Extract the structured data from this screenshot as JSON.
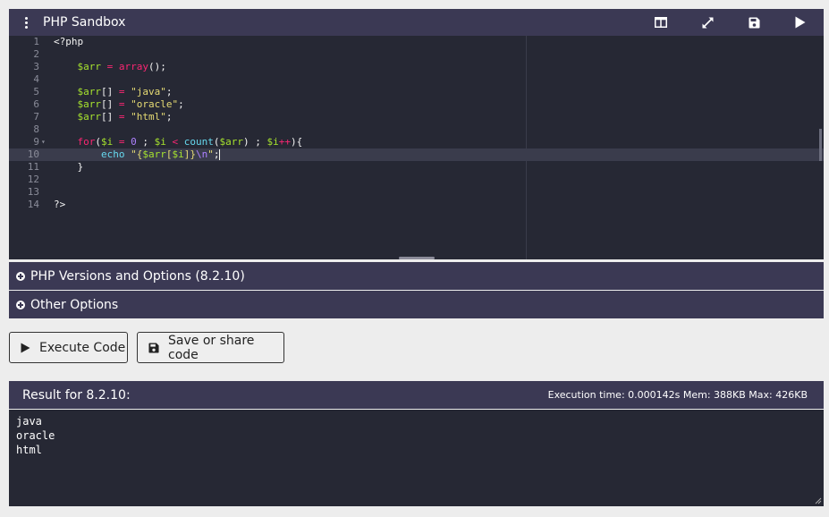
{
  "header": {
    "title": "PHP Sandbox",
    "menu_icon": "kebab-menu-icon",
    "tools": [
      {
        "name": "split-view-button",
        "icon": "split-layout-icon"
      },
      {
        "name": "fullscreen-button",
        "icon": "expand-icon"
      },
      {
        "name": "save-button",
        "icon": "floppy-disk-icon"
      },
      {
        "name": "run-button",
        "icon": "play-icon"
      }
    ]
  },
  "editor": {
    "lines": [
      {
        "num": "1",
        "tokens": [
          {
            "t": "<?php",
            "c": "plain"
          }
        ]
      },
      {
        "num": "2",
        "tokens": []
      },
      {
        "num": "3",
        "tokens": [
          {
            "t": "    ",
            "c": "plain"
          },
          {
            "t": "$arr",
            "c": "var"
          },
          {
            "t": " = ",
            "c": "kw"
          },
          {
            "t": "array",
            "c": "kw"
          },
          {
            "t": "();",
            "c": "plain"
          }
        ]
      },
      {
        "num": "4",
        "tokens": []
      },
      {
        "num": "5",
        "tokens": [
          {
            "t": "    ",
            "c": "plain"
          },
          {
            "t": "$arr",
            "c": "var"
          },
          {
            "t": "[] ",
            "c": "plain"
          },
          {
            "t": "=",
            "c": "kw"
          },
          {
            "t": " ",
            "c": "plain"
          },
          {
            "t": "\"java\"",
            "c": "str"
          },
          {
            "t": ";",
            "c": "plain"
          }
        ]
      },
      {
        "num": "6",
        "tokens": [
          {
            "t": "    ",
            "c": "plain"
          },
          {
            "t": "$arr",
            "c": "var"
          },
          {
            "t": "[] ",
            "c": "plain"
          },
          {
            "t": "=",
            "c": "kw"
          },
          {
            "t": " ",
            "c": "plain"
          },
          {
            "t": "\"oracle\"",
            "c": "str"
          },
          {
            "t": ";",
            "c": "plain"
          }
        ]
      },
      {
        "num": "7",
        "tokens": [
          {
            "t": "    ",
            "c": "plain"
          },
          {
            "t": "$arr",
            "c": "var"
          },
          {
            "t": "[] ",
            "c": "plain"
          },
          {
            "t": "=",
            "c": "kw"
          },
          {
            "t": " ",
            "c": "plain"
          },
          {
            "t": "\"html\"",
            "c": "str"
          },
          {
            "t": ";",
            "c": "plain"
          }
        ]
      },
      {
        "num": "8",
        "tokens": []
      },
      {
        "num": "9",
        "fold": true,
        "tokens": [
          {
            "t": "    ",
            "c": "plain"
          },
          {
            "t": "for",
            "c": "kw"
          },
          {
            "t": "(",
            "c": "plain"
          },
          {
            "t": "$i",
            "c": "var"
          },
          {
            "t": " = ",
            "c": "kw"
          },
          {
            "t": "0",
            "c": "num"
          },
          {
            "t": " ; ",
            "c": "plain"
          },
          {
            "t": "$i",
            "c": "var"
          },
          {
            "t": " < ",
            "c": "kw"
          },
          {
            "t": "count",
            "c": "fn"
          },
          {
            "t": "(",
            "c": "plain"
          },
          {
            "t": "$arr",
            "c": "var"
          },
          {
            "t": ") ; ",
            "c": "plain"
          },
          {
            "t": "$i",
            "c": "var"
          },
          {
            "t": "++",
            "c": "kw"
          },
          {
            "t": "){",
            "c": "plain"
          }
        ]
      },
      {
        "num": "10",
        "active": true,
        "tokens": [
          {
            "t": "        ",
            "c": "plain"
          },
          {
            "t": "echo",
            "c": "fn"
          },
          {
            "t": " ",
            "c": "plain"
          },
          {
            "t": "\"{",
            "c": "str"
          },
          {
            "t": "$arr",
            "c": "var"
          },
          {
            "t": "[",
            "c": "str"
          },
          {
            "t": "$i",
            "c": "var"
          },
          {
            "t": "]}",
            "c": "str"
          },
          {
            "t": "\\n",
            "c": "num"
          },
          {
            "t": "\"",
            "c": "str"
          },
          {
            "t": ";",
            "c": "plain"
          }
        ]
      },
      {
        "num": "11",
        "tokens": [
          {
            "t": "    }",
            "c": "plain"
          }
        ]
      },
      {
        "num": "12",
        "tokens": []
      },
      {
        "num": "13",
        "tokens": []
      },
      {
        "num": "14",
        "tokens": [
          {
            "t": "?>",
            "c": "plain"
          }
        ]
      }
    ]
  },
  "options": {
    "versions_label": "PHP Versions and Options (8.2.10)",
    "other_label": "Other Options"
  },
  "actions": {
    "execute_label": "Execute Code",
    "save_label": "Save or share code"
  },
  "result": {
    "title": "Result for 8.2.10:",
    "exec_info": "Execution time: 0.000142s Mem: 388KB Max: 426KB",
    "output_lines": [
      "java",
      "oracle",
      "html"
    ]
  },
  "colors": {
    "header_bg": "#3b3954",
    "editor_bg": "#262834",
    "page_bg": "#ededed"
  }
}
